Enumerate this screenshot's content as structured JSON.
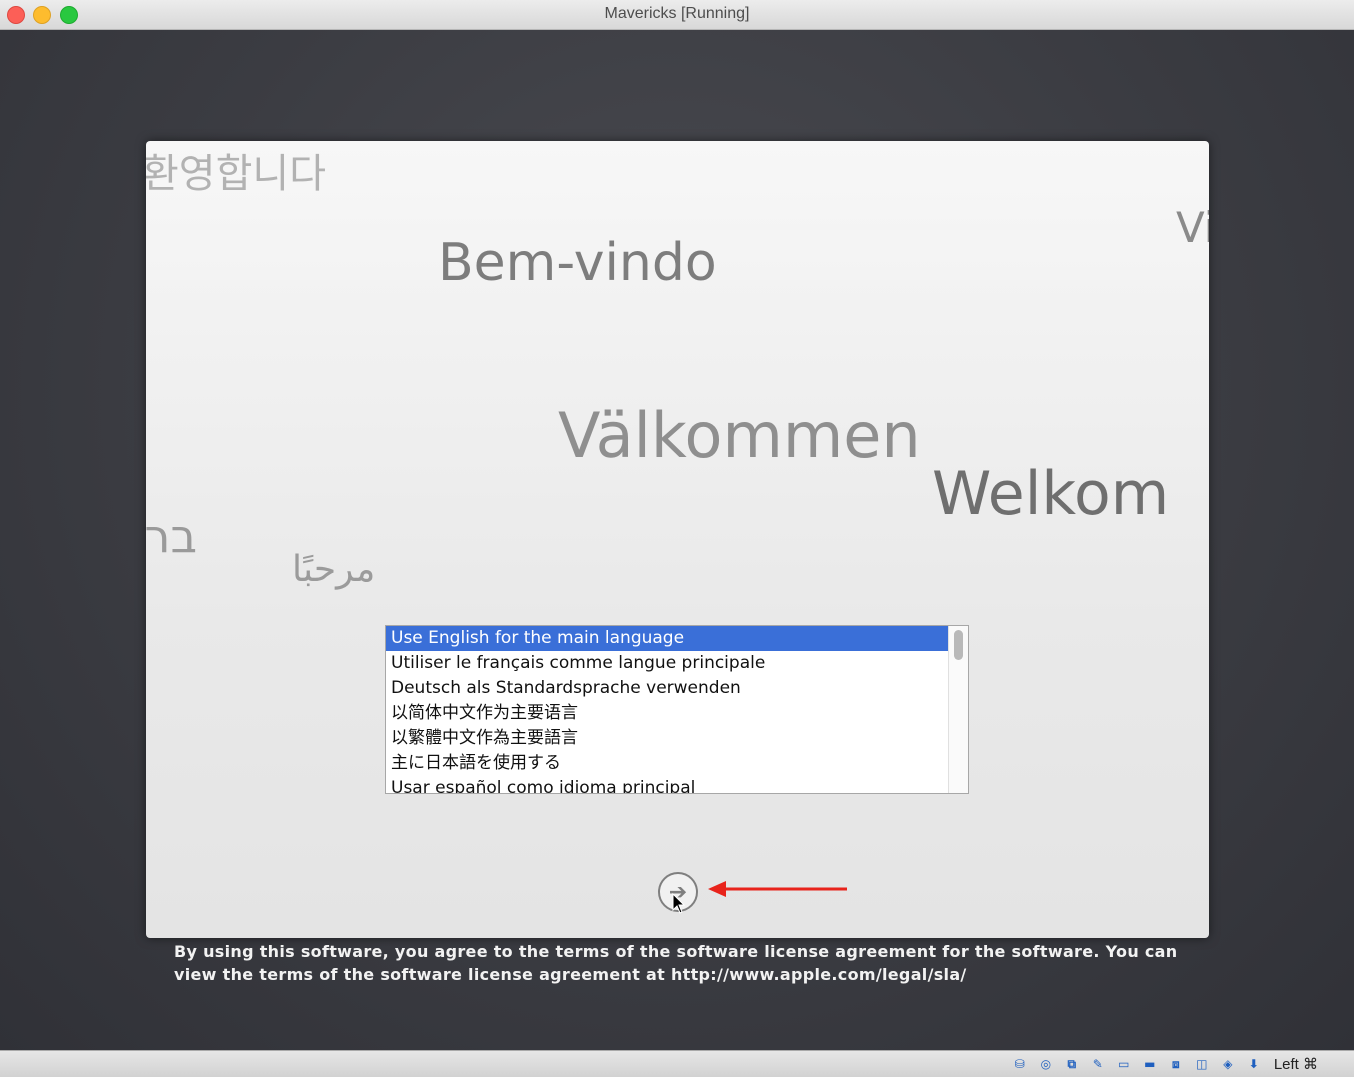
{
  "window": {
    "title": "Mavericks [Running]"
  },
  "greetings": {
    "korean": "환영합니다",
    "portuguese": "Bem-vindo",
    "vietnamese_partial": "Vi",
    "swedish": "Välkommen",
    "dutch": "Welkom",
    "hebrew_partial": "ברו",
    "arabic": "مرحبًا"
  },
  "language_list": {
    "items": [
      "Use English for the main language",
      "Utiliser le français comme langue principale",
      "Deutsch als Standardsprache verwenden",
      "以简体中文作为主要语言",
      "以繁體中文作為主要語言",
      "主に日本語を使用する",
      "Usar español como idioma principal"
    ],
    "selected_index": 0
  },
  "next_button": {
    "icon": "arrow-right-icon"
  },
  "annotation": {
    "arrow_color": "#e8231b"
  },
  "license_text": "By using this software, you agree to the terms of the software license agreement for the software. You can view the terms of the software license agreement at http://www.apple.com/legal/sla/",
  "statusbar": {
    "icons": [
      "hard-disk-icon",
      "optical-drive-icon",
      "usb-icon",
      "pencil-icon",
      "shared-folder-icon",
      "display-icon",
      "network-icon",
      "video-capture-icon",
      "mouse-integration-icon",
      "download-icon"
    ],
    "host_key": "Left ⌘"
  }
}
